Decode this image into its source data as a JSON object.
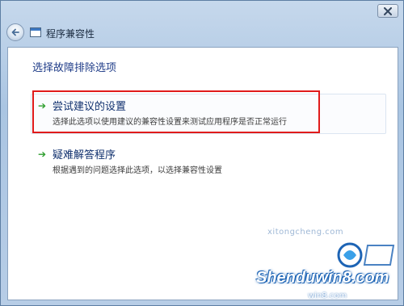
{
  "window": {
    "title": "程序兼容性",
    "close_icon": "close-icon",
    "back_icon": "back-arrow-icon"
  },
  "content": {
    "heading": "选择故障排除选项",
    "options": [
      {
        "title": "尝试建议的设置",
        "description": "选择此选项以使用建议的兼容性设置来测试应用程序是否正常运行",
        "icon": "green-arrow-icon"
      },
      {
        "title": "疑难解答程序",
        "description": "根据遇到的问题选择此选项，以选择兼容性设置",
        "icon": "green-arrow-icon"
      }
    ]
  },
  "watermark": {
    "site": "xitongcheng.com",
    "brand": "Shenduwin8.com",
    "sub": "win8.com"
  },
  "colors": {
    "highlight": "#e01b1b",
    "heading": "#1f3c88",
    "arrow": "#2e9e2e"
  }
}
